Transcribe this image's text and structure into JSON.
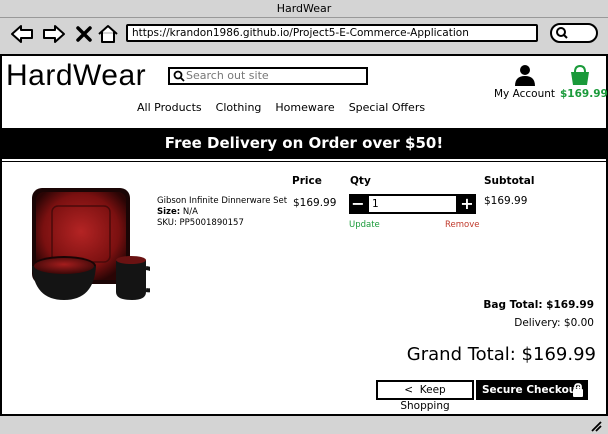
{
  "window": {
    "title": "HardWear"
  },
  "browser": {
    "url": "https://krandon1986.github.io/Project5-E-Commerce-Application"
  },
  "site": {
    "logo": "HardWear",
    "search_placeholder": "Search out site",
    "account_label": "My Account",
    "cart_total": "$169.99",
    "nav": [
      "All Products",
      "Clothing",
      "Homeware",
      "Special Offers"
    ],
    "banner": "Free Delivery on Order over $50!"
  },
  "cart": {
    "columns": {
      "price": "Price",
      "qty": "Qty",
      "subtotal": "Subtotal"
    },
    "item": {
      "name": "Gibson Infinite Dinnerware Set",
      "size_label": "Size:",
      "size_value": "N/A",
      "sku_label": "SKU:",
      "sku_value": "PP5001890157",
      "price": "$169.99",
      "qty": "1",
      "subtotal": "$169.99",
      "update_label": "Update",
      "remove_label": "Remove"
    },
    "bag_total": "Bag Total: $169.99",
    "delivery": "Delivery: $0.00",
    "grand_total": "Grand Total: $169.99",
    "keep_shopping": "Keep Shopping",
    "secure_checkout": "Secure Checkout"
  },
  "colors": {
    "accent_green": "#1a9a3a",
    "remove_red": "#c0392b",
    "banner_bg": "#000000"
  }
}
